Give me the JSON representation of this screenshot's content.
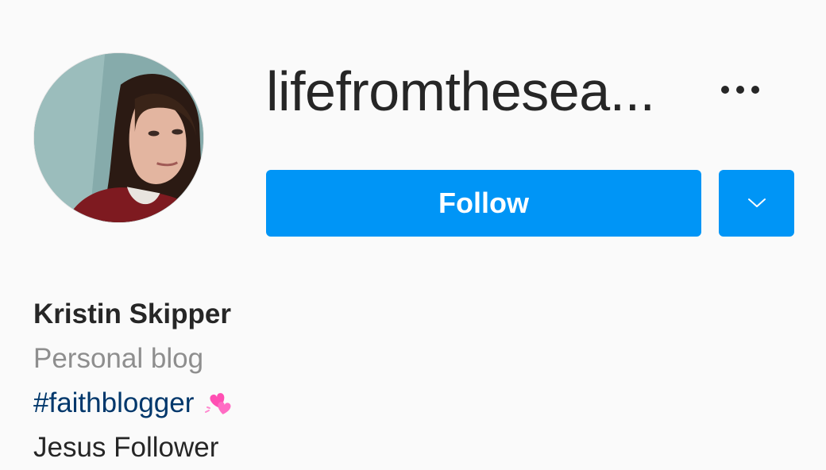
{
  "profile": {
    "username": "lifefromthesea...",
    "follow_label": "Follow",
    "more_icon": "more-horizontal-icon",
    "dropdown_icon": "chevron-down-icon",
    "avatar_alt": "profile-photo"
  },
  "bio": {
    "full_name": "Kristin Skipper",
    "category": "Personal blog",
    "hashtag": "#faithblogger",
    "emoji_icon": "two-hearts-icon",
    "line_text": "Jesus Follower"
  },
  "colors": {
    "accent": "#0095f6",
    "hashtag": "#00376b",
    "muted": "#8e8e8e",
    "text": "#262626",
    "background": "#fafafa"
  }
}
